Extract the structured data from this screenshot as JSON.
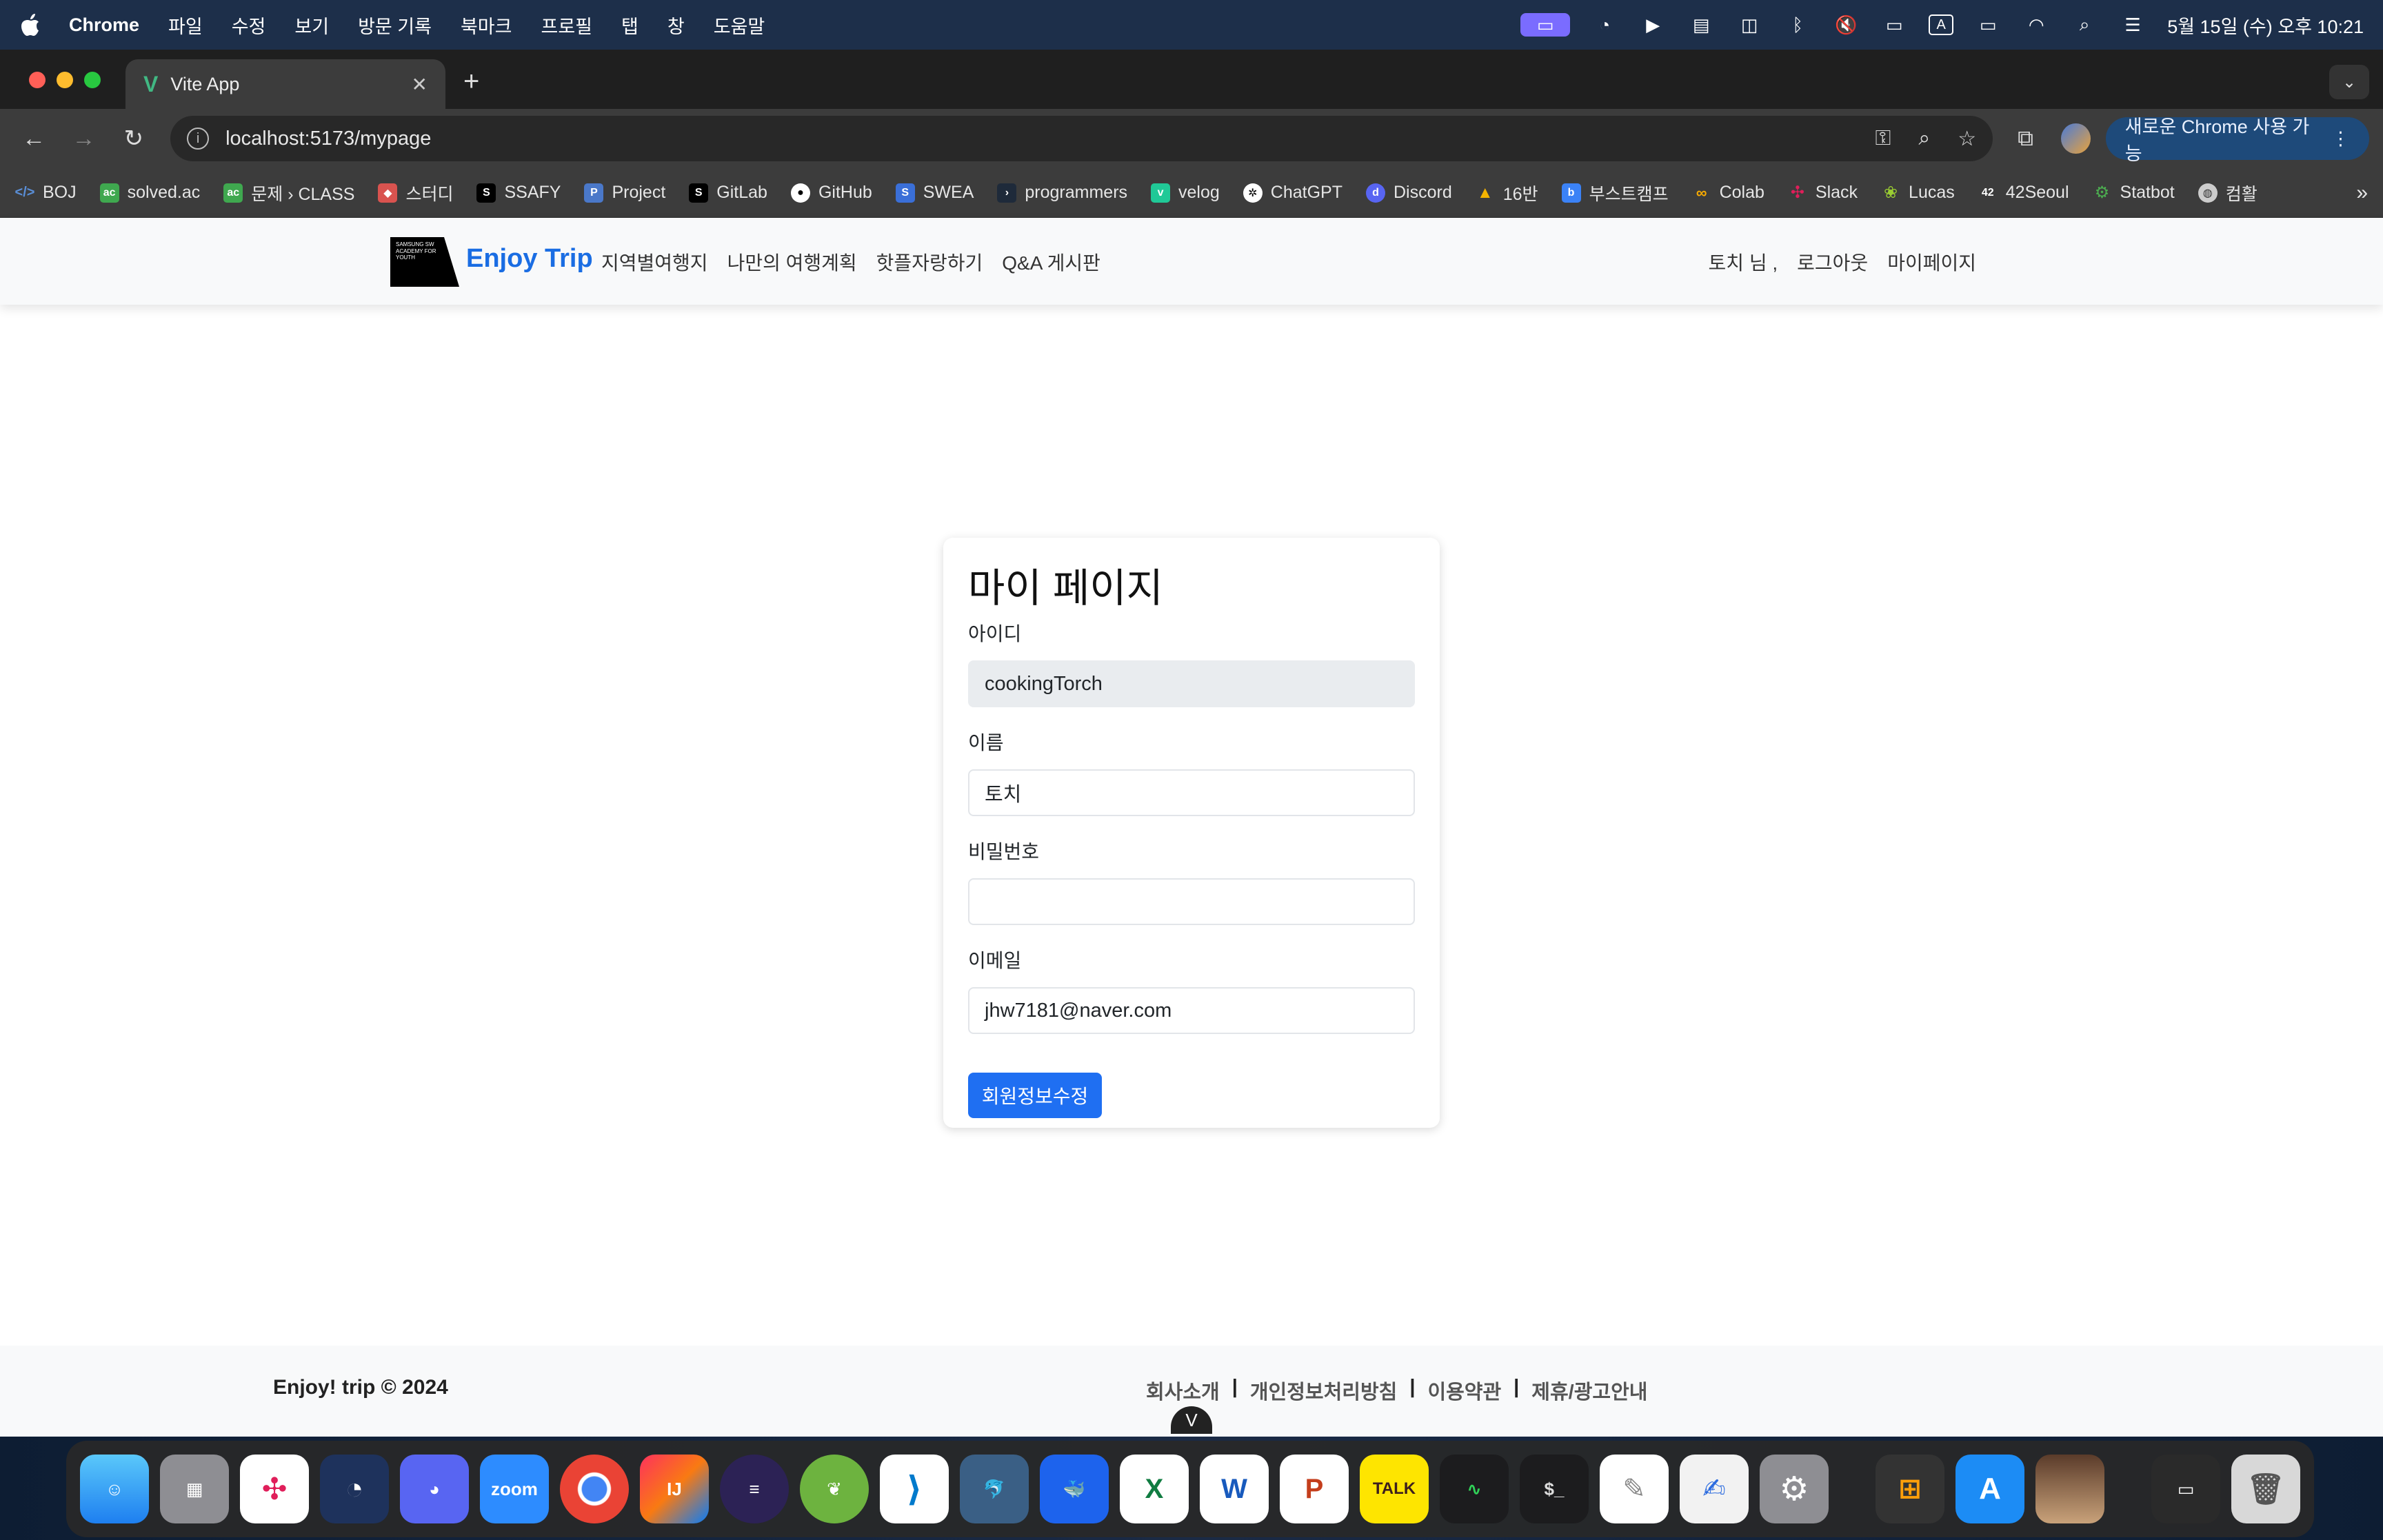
{
  "menubar": {
    "app_name": "Chrome",
    "items": [
      "파일",
      "수정",
      "보기",
      "방문 기록",
      "북마크",
      "프로필",
      "탭",
      "창",
      "도움말"
    ],
    "clock": "5월 15일 (수) 오후 10:21",
    "input_indicator": "A"
  },
  "browser": {
    "tab_title": "Vite App",
    "url": "localhost:5173/mypage",
    "update_button": "새로운 Chrome 사용 가능",
    "bookmarks": [
      "BOJ",
      "solved.ac",
      "문제 › CLASS",
      "스터디",
      "SSAFY",
      "Project",
      "GitLab",
      "GitHub",
      "SWEA",
      "programmers",
      "velog",
      "ChatGPT",
      "Discord",
      "16반",
      "부스트캠프",
      "Colab",
      "Slack",
      "Lucas",
      "42Seoul",
      "Statbot",
      "컴활"
    ]
  },
  "navbar": {
    "logo_text": "SAMSUNG SW ACADEMY FOR YOUTH",
    "brand": "Enjoy Trip",
    "links": [
      "지역별여행지",
      "나만의 여행계획",
      "핫플자랑하기",
      "Q&A 게시판"
    ],
    "user_greeting": "토치 님 ,",
    "logout": "로그아웃",
    "mypage": "마이페이지"
  },
  "mypage": {
    "title": "마이 페이지",
    "id_label": "아이디",
    "id_value": "cookingTorch",
    "name_label": "이름",
    "name_value": "토치",
    "password_label": "비밀번호",
    "password_value": "",
    "email_label": "이메일",
    "email_value": "jhw7181@naver.com",
    "submit_label": "회원정보수정"
  },
  "footer": {
    "copyright": "Enjoy! trip © 2024",
    "links": [
      "회사소개",
      "개인정보처리방침",
      "이용약관",
      "제휴/광고안내"
    ],
    "separator": "|"
  },
  "dock": {
    "apps": [
      "Finder",
      "Launchpad",
      "Slack",
      "Mattermost",
      "Discord",
      "zoom",
      "Chrome",
      "IntelliJ",
      "Eclipse",
      "Spring",
      "VS Code",
      "MySQL Workbench",
      "Docker",
      "Excel",
      "Word",
      "PowerPoint",
      "KakaoTalk",
      "Activity Monitor",
      "Terminal",
      "TextEdit",
      "Script Editor",
      "System Settings",
      "Calculator",
      "App Store",
      "Photo",
      "Downloads",
      "Trash"
    ],
    "zoom_label": "zoom",
    "kakao_label": "TALK"
  },
  "colors": {
    "brand_blue": "#1a6de3",
    "button_blue": "#1f6ff2",
    "menubar_bg": "#1d2f4a"
  }
}
